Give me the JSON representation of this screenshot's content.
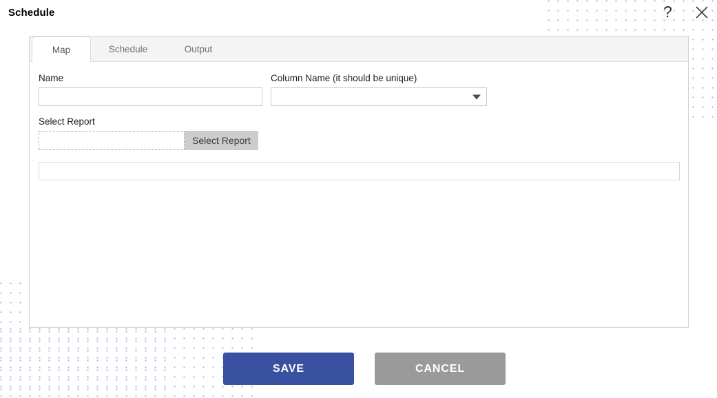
{
  "window": {
    "title": "Schedule",
    "help_icon": "question-mark-icon",
    "close_icon": "close-x-icon"
  },
  "tabs": [
    {
      "id": "map",
      "label": "Map",
      "active": true
    },
    {
      "id": "schedule",
      "label": "Schedule",
      "active": false
    },
    {
      "id": "output",
      "label": "Output",
      "active": false
    }
  ],
  "form": {
    "name": {
      "label": "Name",
      "value": "",
      "placeholder": ""
    },
    "column_name": {
      "label": "Column Name (it should be unique)",
      "value": "",
      "placeholder": "",
      "caret_icon": "chevron-down-icon"
    },
    "select_report": {
      "label": "Select Report",
      "value": "",
      "placeholder": "",
      "button_label": "Select Report"
    },
    "extra_field": {
      "value": "",
      "placeholder": ""
    }
  },
  "footer": {
    "save_label": "SAVE",
    "cancel_label": "CANCEL"
  },
  "colors": {
    "save_background": "#3a50a0",
    "cancel_background": "#9a9a9a",
    "button_text": "#ffffff",
    "panel_border": "#d3d3d3",
    "tabbar_background": "#f4f4f4",
    "select_report_button": "#cccccc",
    "dot_pattern": "#aab4e0"
  }
}
